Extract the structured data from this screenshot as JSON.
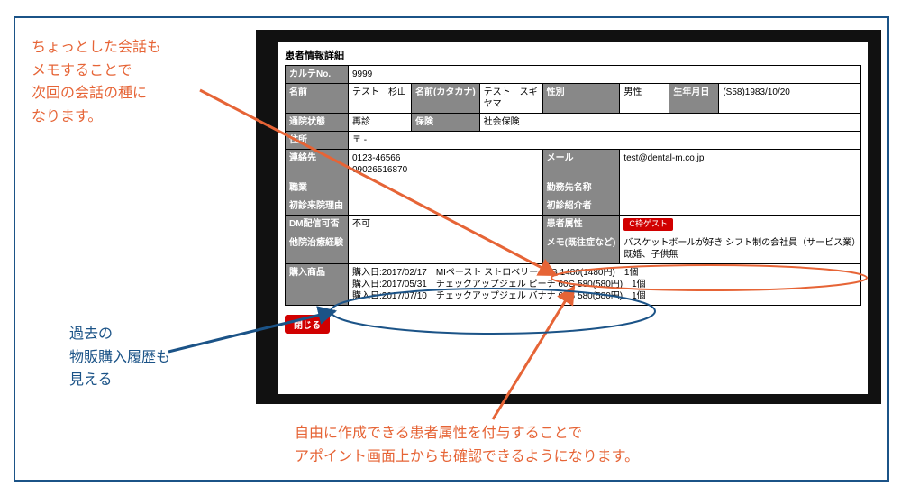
{
  "annotations": {
    "memo_note": "ちょっとした会話も\nメモすることで\n次回の会話の種に\nなります。",
    "history_note": "過去の\n物販購入履歴も\n見える",
    "attr_note": "自由に作成できる患者属性を付与することで\nアポイント画面上からも確認できるようになります。"
  },
  "panel": {
    "title": "患者情報詳細",
    "labels": {
      "karte_no": "カルテNo.",
      "name": "名前",
      "name_kana": "名前(カタカナ)",
      "gender": "性別",
      "birth": "生年月日",
      "visit_status": "通院状態",
      "insurance": "保険",
      "address": "住所",
      "contact": "連絡先",
      "mail": "メール",
      "occupation": "職業",
      "work_name": "勤務先名称",
      "first_visit_reason": "初診来院理由",
      "first_referrer": "初診紹介者",
      "dm_ok": "DM配信可否",
      "patient_attr": "患者属性",
      "other_history": "他院治療経験",
      "memo": "メモ(既往症など)",
      "purchases": "購入商品"
    },
    "values": {
      "karte_no": "9999",
      "name": "テスト　杉山",
      "name_kana": "テスト　スギヤマ",
      "gender": "男性",
      "birth": "(S58)1983/10/20",
      "visit_status": "再診",
      "insurance": "社会保険",
      "address": "〒 -",
      "contact": "0123-46566\n09026516870",
      "mail": "test@dental-m.co.jp",
      "occupation": "",
      "work_name": "",
      "first_visit_reason": "",
      "first_referrer": "",
      "dm_ok": "不可",
      "patient_attr_badge": "C枠ゲスト",
      "other_history": "",
      "memo": "バスケットボールが好き シフト制の会社員（サービス業）既婚、子供無",
      "purchases": "購入日:2017/02/17　MIペースト ストロベリー 40G 1480(1480円)　1個\n購入日:2017/05/31　チェックアップジェル ピーチ 60G 580(580円)　1個\n購入日:2017/07/10　チェックアップジェル バナナ 60G 580(580円)　1個"
    },
    "close_label": "閉じる"
  }
}
